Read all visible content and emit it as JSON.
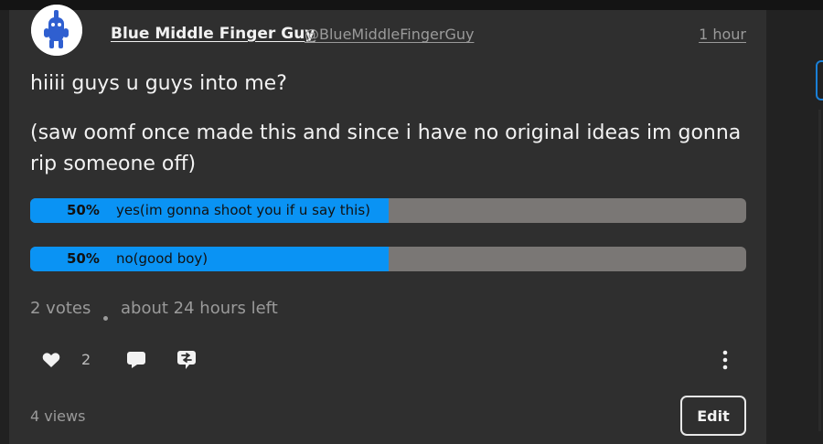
{
  "post": {
    "author_name": "Blue Middle Finger Guy",
    "author_handle": "@BlueMiddleFingerGuy",
    "time": "1 hour",
    "body_line_1": "hiiii guys u guys into me?",
    "body_line_2": "(saw oomf once made this and since i have no original ideas im gonna",
    "body_line_3": "rip someone off)"
  },
  "poll": {
    "options": [
      {
        "percent_label": "50%",
        "label": "yes(im gonna shoot you if u say this)",
        "share": 0.5
      },
      {
        "percent_label": "50%",
        "label": "no(good boy)",
        "share": 0.5
      }
    ],
    "votes": "2 votes",
    "time_left": "about 24 hours left"
  },
  "actions": {
    "like_count": "2",
    "icons": [
      "heart-icon",
      "comment-icon",
      "repost-icon",
      "more-vertical-icon"
    ]
  },
  "footer": {
    "views": "4 views",
    "edit_label": "Edit"
  },
  "colors": {
    "card_bg": "#2f2f2f",
    "poll_fill": "#0a93f4",
    "poll_track": "#7a7775",
    "avatar_figure": "#2f5fd0"
  }
}
